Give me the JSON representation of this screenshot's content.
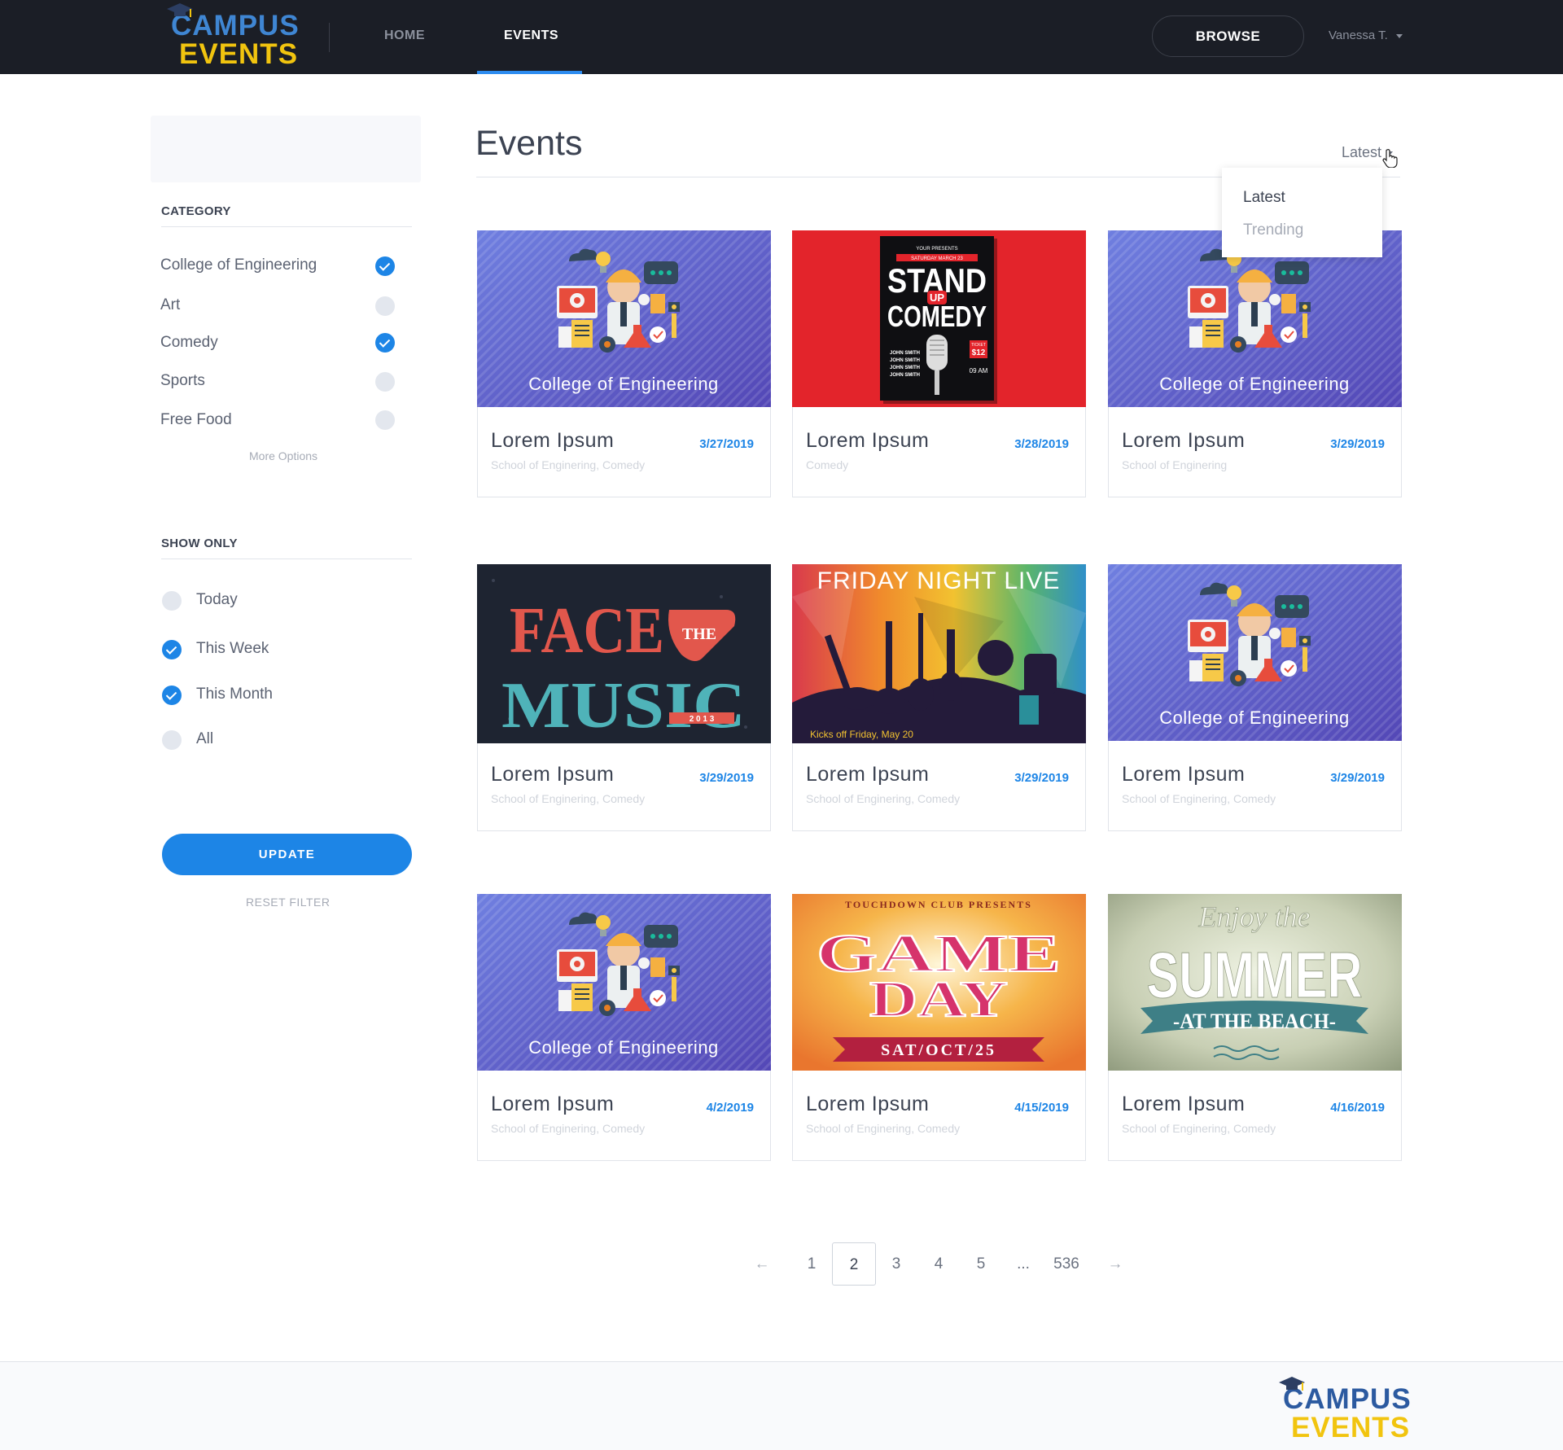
{
  "header": {
    "logo_line1": "CAMPUS",
    "logo_line2": "EVENTS",
    "nav": [
      {
        "label": "HOME"
      },
      {
        "label": "EVENTS"
      }
    ],
    "browse_label": "BROWSE",
    "user_name": "Vanessa T."
  },
  "sidebar": {
    "category_heading": "CATEGORY",
    "categories": [
      {
        "label": "College of Engineering",
        "checked": true
      },
      {
        "label": "Art",
        "checked": false
      },
      {
        "label": "Comedy",
        "checked": true
      },
      {
        "label": "Sports",
        "checked": false
      },
      {
        "label": "Free Food",
        "checked": false
      }
    ],
    "more_options": "More Options",
    "show_only_heading": "SHOW ONLY",
    "show_only": [
      {
        "label": "Today",
        "checked": false
      },
      {
        "label": "This Week",
        "checked": true
      },
      {
        "label": "This Month",
        "checked": true
      },
      {
        "label": "All",
        "checked": false
      }
    ],
    "update_label": "UPDATE",
    "reset_label": "RESET FILTER"
  },
  "main": {
    "title": "Events",
    "sort_label": "Latest",
    "sort_options": [
      "Latest",
      "Trending"
    ],
    "events": [
      {
        "title": "Lorem Ipsum",
        "date": "3/27/2019",
        "tags": "School of Enginering, Comedy",
        "image": "engineering",
        "image_caption": "College of Engineering"
      },
      {
        "title": "Lorem Ipsum",
        "date": "3/28/2019",
        "tags": "Comedy",
        "image": "standup-comedy",
        "image_caption": ""
      },
      {
        "title": "Lorem Ipsum",
        "date": "3/29/2019",
        "tags": "School of Enginering",
        "image": "engineering",
        "image_caption": "College of Engineering"
      },
      {
        "title": "Lorem Ipsum",
        "date": "3/29/2019",
        "tags": "School of Enginering, Comedy",
        "image": "face-the-music",
        "image_caption": ""
      },
      {
        "title": "Lorem Ipsum",
        "date": "3/29/2019",
        "tags": "School of Enginering, Comedy",
        "image": "friday-night-live",
        "image_caption": "FRIDAY NIGHT LIVE"
      },
      {
        "title": "Lorem Ipsum",
        "date": "3/29/2019",
        "tags": "School of Enginering, Comedy",
        "image": "engineering",
        "image_caption": "College of Engineering"
      },
      {
        "title": "Lorem Ipsum",
        "date": "4/2/2019",
        "tags": "School of Enginering, Comedy",
        "image": "engineering",
        "image_caption": "College of Engineering"
      },
      {
        "title": "Lorem Ipsum",
        "date": "4/15/2019",
        "tags": "School of Enginering, Comedy",
        "image": "game-day",
        "image_caption": ""
      },
      {
        "title": "Lorem Ipsum",
        "date": "4/16/2019",
        "tags": "School of Enginering, Comedy",
        "image": "summer-beach",
        "image_caption": ""
      }
    ],
    "poster_text": {
      "standup_top": "YOUR PRESENTS",
      "standup_date": "SATURDAY MARCH 23",
      "standup_line1": "STAND",
      "standup_up": "UP",
      "standup_line2": "COMEDY",
      "standup_names": "JOHN SMITH",
      "standup_ticket": "TICKET",
      "standup_price": "$12",
      "standup_time": "09 AM",
      "face_line1": "FACE",
      "face_the": "THE",
      "face_line2": "MUSIC",
      "face_year": "2 0 1 3",
      "fnl_sub": "Kicks off Friday, May 20",
      "game_top": "TOUCHDOWN CLUB PRESENTS",
      "game_line1": "GAME",
      "game_line2": "DAY",
      "game_date": "SAT/OCT/25",
      "summer_top": "Enjoy the",
      "summer_main": "SUMMER",
      "summer_banner": "-AT THE BEACH-"
    }
  },
  "pagination": {
    "prev": "←",
    "pages": [
      "1",
      "2",
      "3",
      "4",
      "5",
      "...",
      "536"
    ],
    "current": "2",
    "next": "→"
  },
  "footer": {
    "logo_line1": "CAMPUS",
    "logo_line2": "EVENTS"
  },
  "colors": {
    "accent": "#1d85e6",
    "header_bg": "#1b1e26",
    "logo_blue": "#3f86d3",
    "logo_yellow": "#f1c40f"
  }
}
